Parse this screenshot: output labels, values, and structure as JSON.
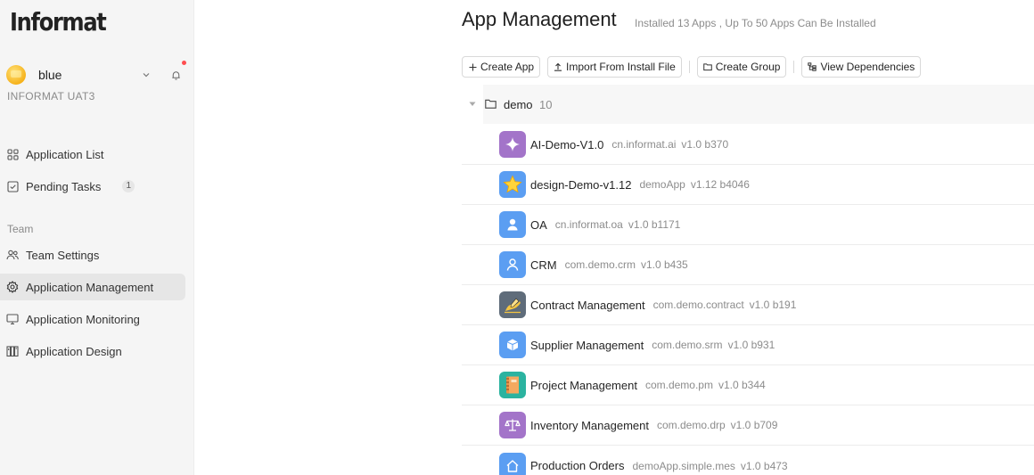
{
  "sidebar": {
    "logo": "Informat",
    "team": {
      "name": "blue",
      "org": "INFORMAT UAT3"
    },
    "nav_top": [
      {
        "label": "Application List",
        "icon": "grid-icon"
      },
      {
        "label": "Pending Tasks",
        "icon": "checkbox-icon",
        "badge": "1"
      }
    ],
    "section_label": "Team",
    "nav_team": [
      {
        "label": "Team Settings",
        "icon": "team-icon"
      },
      {
        "label": "Application Management",
        "icon": "gear-icon",
        "active": true
      },
      {
        "label": "Application Monitoring",
        "icon": "monitor-icon"
      },
      {
        "label": "Application Design",
        "icon": "design-icon"
      }
    ]
  },
  "main": {
    "title": "App Management",
    "subtitle": "Installed 13 Apps , Up To 50 Apps Can Be Installed",
    "toolbar": {
      "create_app": "Create App",
      "import_file": "Import From Install File",
      "create_group": "Create Group",
      "view_dependencies": "View Dependencies"
    },
    "group": {
      "name": "demo",
      "count": "10"
    },
    "apps": [
      {
        "name": "AI-Demo-V1.0",
        "id": "cn.informat.ai",
        "version": "v1.0 b370",
        "icon": "sparkle-icon",
        "color": "#a374c9"
      },
      {
        "name": "design-Demo-v1.12",
        "id": "demoApp",
        "version": "v1.12 b4046",
        "icon": "star-icon",
        "color": "#5b9ef2"
      },
      {
        "name": "OA",
        "id": "cn.informat.oa",
        "version": "v1.0 b1171",
        "icon": "user-icon",
        "color": "#5b9ef2"
      },
      {
        "name": "CRM",
        "id": "com.demo.crm",
        "version": "v1.0 b435",
        "icon": "user-outline-icon",
        "color": "#5b9ef2"
      },
      {
        "name": "Contract Management",
        "id": "com.demo.contract",
        "version": "v1.0 b191",
        "icon": "signing-hand-icon",
        "color": "#5f6c7a"
      },
      {
        "name": "Supplier Management",
        "id": "com.demo.srm",
        "version": "v1.0 b931",
        "icon": "cube-icon",
        "color": "#5b9ef2"
      },
      {
        "name": "Project Management",
        "id": "com.demo.pm",
        "version": "v1.0 b344",
        "icon": "notebook-icon",
        "color": "#2bb3a0"
      },
      {
        "name": "Inventory Management",
        "id": "com.demo.drp",
        "version": "v1.0 b709",
        "icon": "scale-icon",
        "color": "#a374c9"
      },
      {
        "name": "Production Orders",
        "id": "demoApp.simple.mes",
        "version": "v1.0 b473",
        "icon": "home-icon",
        "color": "#5b9ef2"
      }
    ]
  }
}
